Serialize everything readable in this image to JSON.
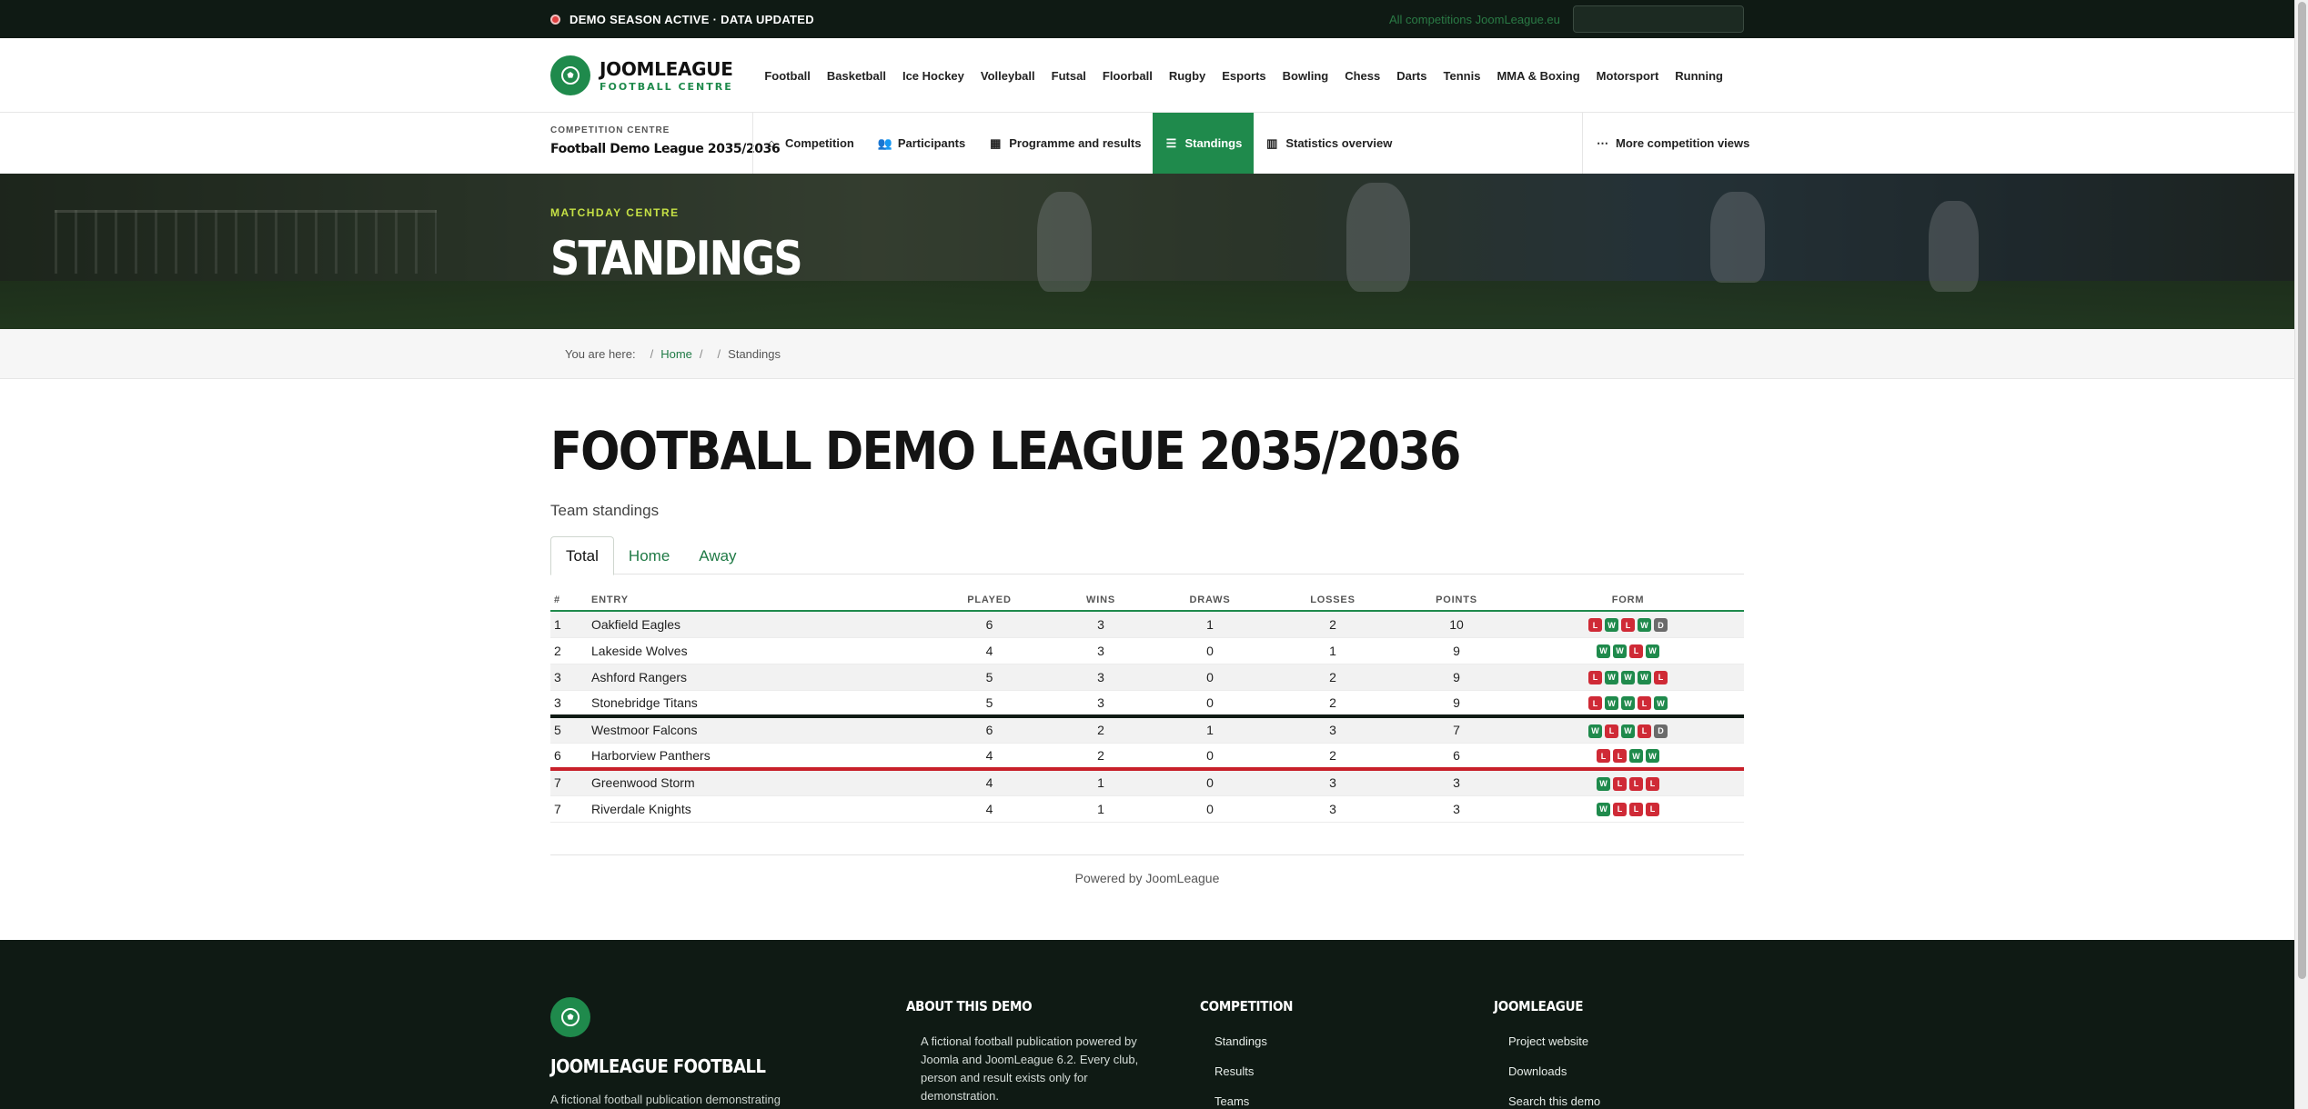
{
  "topbar": {
    "status": "DEMO SEASON ACTIVE · DATA UPDATED",
    "all_competitions": "All competitions JoomLeague.eu",
    "search_placeholder": ""
  },
  "brand": {
    "name": "JOOMLEAGUE",
    "sub": "FOOTBALL CENTRE",
    "accent": "#1f8a4c"
  },
  "mainnav": [
    "Football",
    "Basketball",
    "Ice Hockey",
    "Volleyball",
    "Futsal",
    "Floorball",
    "Rugby",
    "Esports",
    "Bowling",
    "Chess",
    "Darts",
    "Tennis",
    "MMA & Boxing",
    "Motorsport",
    "Running"
  ],
  "competition": {
    "label": "COMPETITION CENTRE",
    "name": "Football Demo League 2035/2036",
    "tabs": [
      {
        "label": "Competition",
        "icon": "home-icon",
        "active": false
      },
      {
        "label": "Participants",
        "icon": "users-icon",
        "active": false
      },
      {
        "label": "Programme and results",
        "icon": "calendar-icon",
        "active": false
      },
      {
        "label": "Standings",
        "icon": "list-icon",
        "active": true
      },
      {
        "label": "Statistics overview",
        "icon": "chart-icon",
        "active": false
      }
    ],
    "more": "More competition views"
  },
  "hero": {
    "eyebrow": "MATCHDAY CENTRE",
    "title": "STANDINGS"
  },
  "breadcrumb": {
    "prefix": "You are here:",
    "home": "Home",
    "current": "Standings"
  },
  "main": {
    "title": "FOOTBALL DEMO LEAGUE 2035/2036",
    "subtitle": "Team standings",
    "view_tabs": [
      "Total",
      "Home",
      "Away"
    ],
    "active_view": "Total"
  },
  "table": {
    "headers": {
      "rank": "#",
      "entry": "ENTRY",
      "played": "PLAYED",
      "wins": "WINS",
      "draws": "DRAWS",
      "losses": "LOSSES",
      "points": "POINTS",
      "form": "FORM"
    },
    "rows": [
      {
        "rank": "1",
        "team": "Oakfield Eagles",
        "played": "6",
        "wins": "3",
        "draws": "1",
        "losses": "2",
        "points": "10",
        "form": [
          "L",
          "W",
          "L",
          "W",
          "D"
        ]
      },
      {
        "rank": "2",
        "team": "Lakeside Wolves",
        "played": "4",
        "wins": "3",
        "draws": "0",
        "losses": "1",
        "points": "9",
        "form": [
          "W",
          "W",
          "L",
          "W"
        ]
      },
      {
        "rank": "3",
        "team": "Ashford Rangers",
        "played": "5",
        "wins": "3",
        "draws": "0",
        "losses": "2",
        "points": "9",
        "form": [
          "L",
          "W",
          "W",
          "W",
          "L"
        ]
      },
      {
        "rank": "3",
        "team": "Stonebridge Titans",
        "played": "5",
        "wins": "3",
        "draws": "0",
        "losses": "2",
        "points": "9",
        "form": [
          "L",
          "W",
          "W",
          "L",
          "W"
        ]
      },
      {
        "rank": "5",
        "team": "Westmoor Falcons",
        "played": "6",
        "wins": "2",
        "draws": "1",
        "losses": "3",
        "points": "7",
        "form": [
          "W",
          "L",
          "W",
          "L",
          "D"
        ]
      },
      {
        "rank": "6",
        "team": "Harborview Panthers",
        "played": "4",
        "wins": "2",
        "draws": "0",
        "losses": "2",
        "points": "6",
        "form": [
          "L",
          "L",
          "W",
          "W"
        ]
      },
      {
        "rank": "7",
        "team": "Greenwood Storm",
        "played": "4",
        "wins": "1",
        "draws": "0",
        "losses": "3",
        "points": "3",
        "form": [
          "W",
          "L",
          "L",
          "L"
        ]
      },
      {
        "rank": "7",
        "team": "Riverdale Knights",
        "played": "4",
        "wins": "1",
        "draws": "0",
        "losses": "3",
        "points": "3",
        "form": [
          "W",
          "L",
          "L",
          "L"
        ]
      }
    ],
    "powered": "Powered by JoomLeague"
  },
  "footer": {
    "brand": "JOOMLEAGUE FOOTBALL",
    "desc": "A fictional football publication demonstrating",
    "about_title": "ABOUT THIS DEMO",
    "about_text": "A fictional football publication powered by Joomla and JoomLeague 6.2. Every club, person and result exists only for demonstration.",
    "comp_title": "COMPETITION",
    "comp_links": [
      "Standings",
      "Results",
      "Teams"
    ],
    "jl_title": "JOOMLEAGUE",
    "jl_links": [
      "Project website",
      "Downloads",
      "Search this demo"
    ]
  }
}
